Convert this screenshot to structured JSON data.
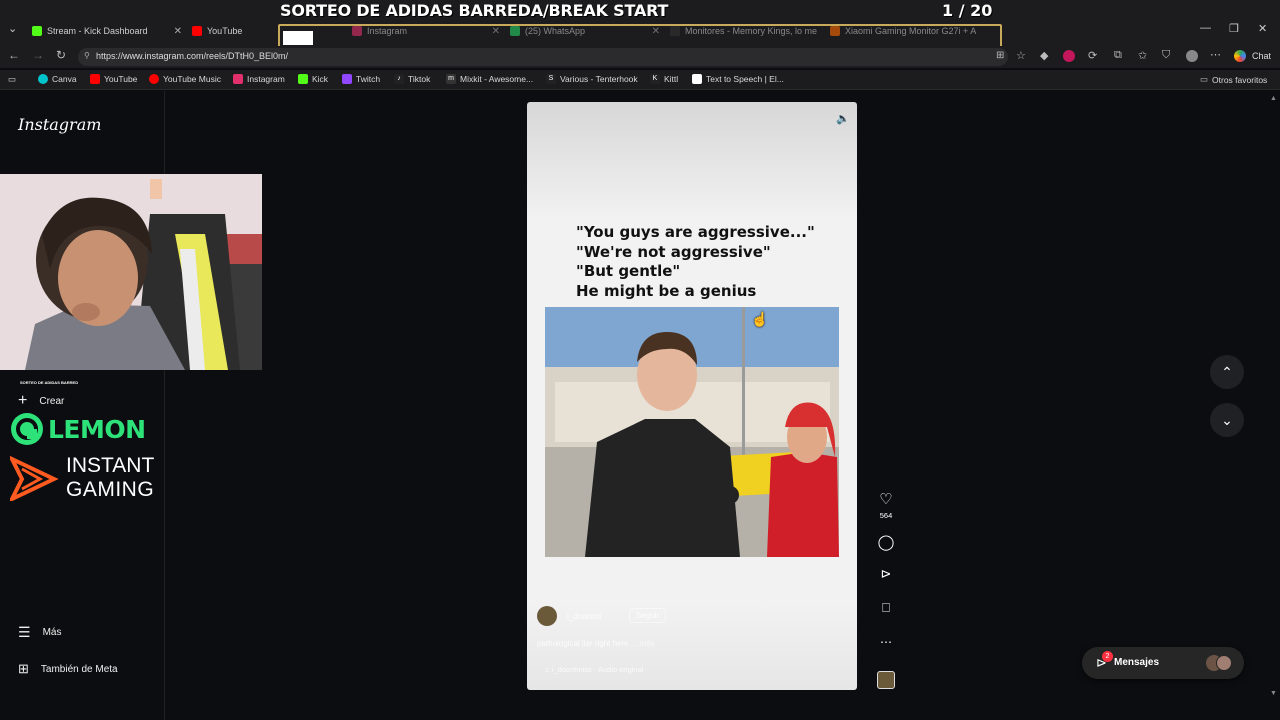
{
  "browser": {
    "tabs": [
      {
        "label": "Stream - Kick Dashboard",
        "color": "#53fc18"
      },
      {
        "label": "YouTube",
        "color": "#ff0000"
      },
      {
        "label": "Instagram",
        "color": "#e1306c"
      },
      {
        "label": "(25) WhatsApp",
        "color": "#25d366"
      },
      {
        "label": "Monitores - Memory Kings, lo me",
        "color": "#1a1a1a"
      },
      {
        "label": "Xiaomi Gaming Monitor G27i + A",
        "color": "#ff6900"
      }
    ],
    "url": "https://www.instagram.com/reels/DTtH0_BEl0m/",
    "chat_label": "Chat",
    "bookmarks": [
      {
        "label": "Canva",
        "color": "#00c4cc"
      },
      {
        "label": "YouTube",
        "color": "#ff0000"
      },
      {
        "label": "YouTube Music",
        "color": "#ff0000"
      },
      {
        "label": "Instagram",
        "color": "#e1306c"
      },
      {
        "label": "Kick",
        "color": "#53fc18"
      },
      {
        "label": "Twitch",
        "color": "#9146ff"
      },
      {
        "label": "Tiktok",
        "color": "#111111"
      },
      {
        "label": "Mixkit - Awesome...",
        "color": "#222222"
      },
      {
        "label": "Various - Tenterhook",
        "color": "#111111"
      },
      {
        "label": "Kittl",
        "color": "#111111"
      },
      {
        "label": "Text to Speech | El...",
        "color": "#ffffff"
      }
    ],
    "other_bookmarks": "Otros favoritos"
  },
  "stream_overlay": {
    "title": "SORTEO DE ADIDAS BARREDA/BREAK START",
    "counter": "1  / 20",
    "small_text": "SORTEO DE ADIDAS BARRED",
    "sponsor_1": "LEMON",
    "sponsor_2_line1": "INSTANT",
    "sponsor_2_line2": "GAMING"
  },
  "sidebar": {
    "logo": "Instagram",
    "items": [
      {
        "label": "Crear",
        "icon": "plus-icon"
      },
      {
        "label": "Más",
        "icon": "menu-icon"
      },
      {
        "label": "También de Meta",
        "icon": "grid-icon"
      }
    ]
  },
  "reel": {
    "caption_lines": [
      "\"You guys are aggressive...\"",
      "\"We're not aggressive\"",
      "\"But gentle\"",
      "He might be a genius"
    ],
    "username": "i_doontmi",
    "follow_label": "Seguir",
    "description": "pathological liar right here ...",
    "more_label": "más",
    "audio": "i_doontmiss · Audio original"
  },
  "actions": {
    "likes_count": "564"
  },
  "messages": {
    "label": "Mensajes",
    "badge": "2"
  },
  "colors": {
    "accent_green": "#2ee27a",
    "badge_red": "#ff3040"
  }
}
